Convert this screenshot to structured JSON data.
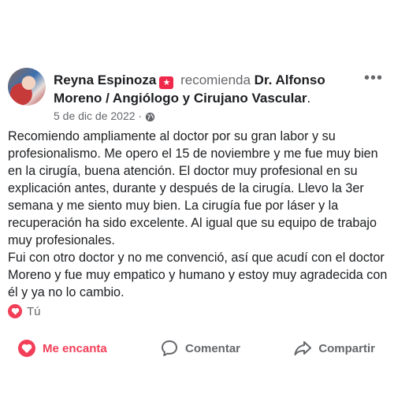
{
  "post": {
    "author": "Reyna Espinoza",
    "badge_glyph": "★",
    "recommend_text": "recomienda",
    "business": "Dr. Alfonso Moreno / Angiólogo y Cirujano Vascular",
    "business_suffix": ".",
    "date": "5 de dic de 2022 · ",
    "privacy_icon": "globe-icon",
    "more_glyph": "•••",
    "body": "Recomiendo ampliamente al doctor por su gran labor y su profesionalismo. Me opero el 15 de noviembre y me fue muy bien en la cirugía, buena atención. El doctor muy profesional en su explicación antes, durante y después de la cirugía. Llevo la 3er semana y me siento muy bien. La cirugía fue por láser y la recuperación ha sido excelente. Al igual que su equipo de trabajo muy profesionales.\nFui con otro doctor y no me convenció, así que acudí con el doctor Moreno y fue muy empatico y humano y estoy muy agradecida con él y ya no lo cambio."
  },
  "reactions": {
    "icon": "heart-icon",
    "label": "Tú"
  },
  "actions": {
    "love": "Me encanta",
    "comment": "Comentar",
    "share": "Compartir"
  },
  "colors": {
    "love": "#f33e58",
    "badge": "#f02849",
    "muted": "#65676b",
    "text": "#1c1e21"
  }
}
